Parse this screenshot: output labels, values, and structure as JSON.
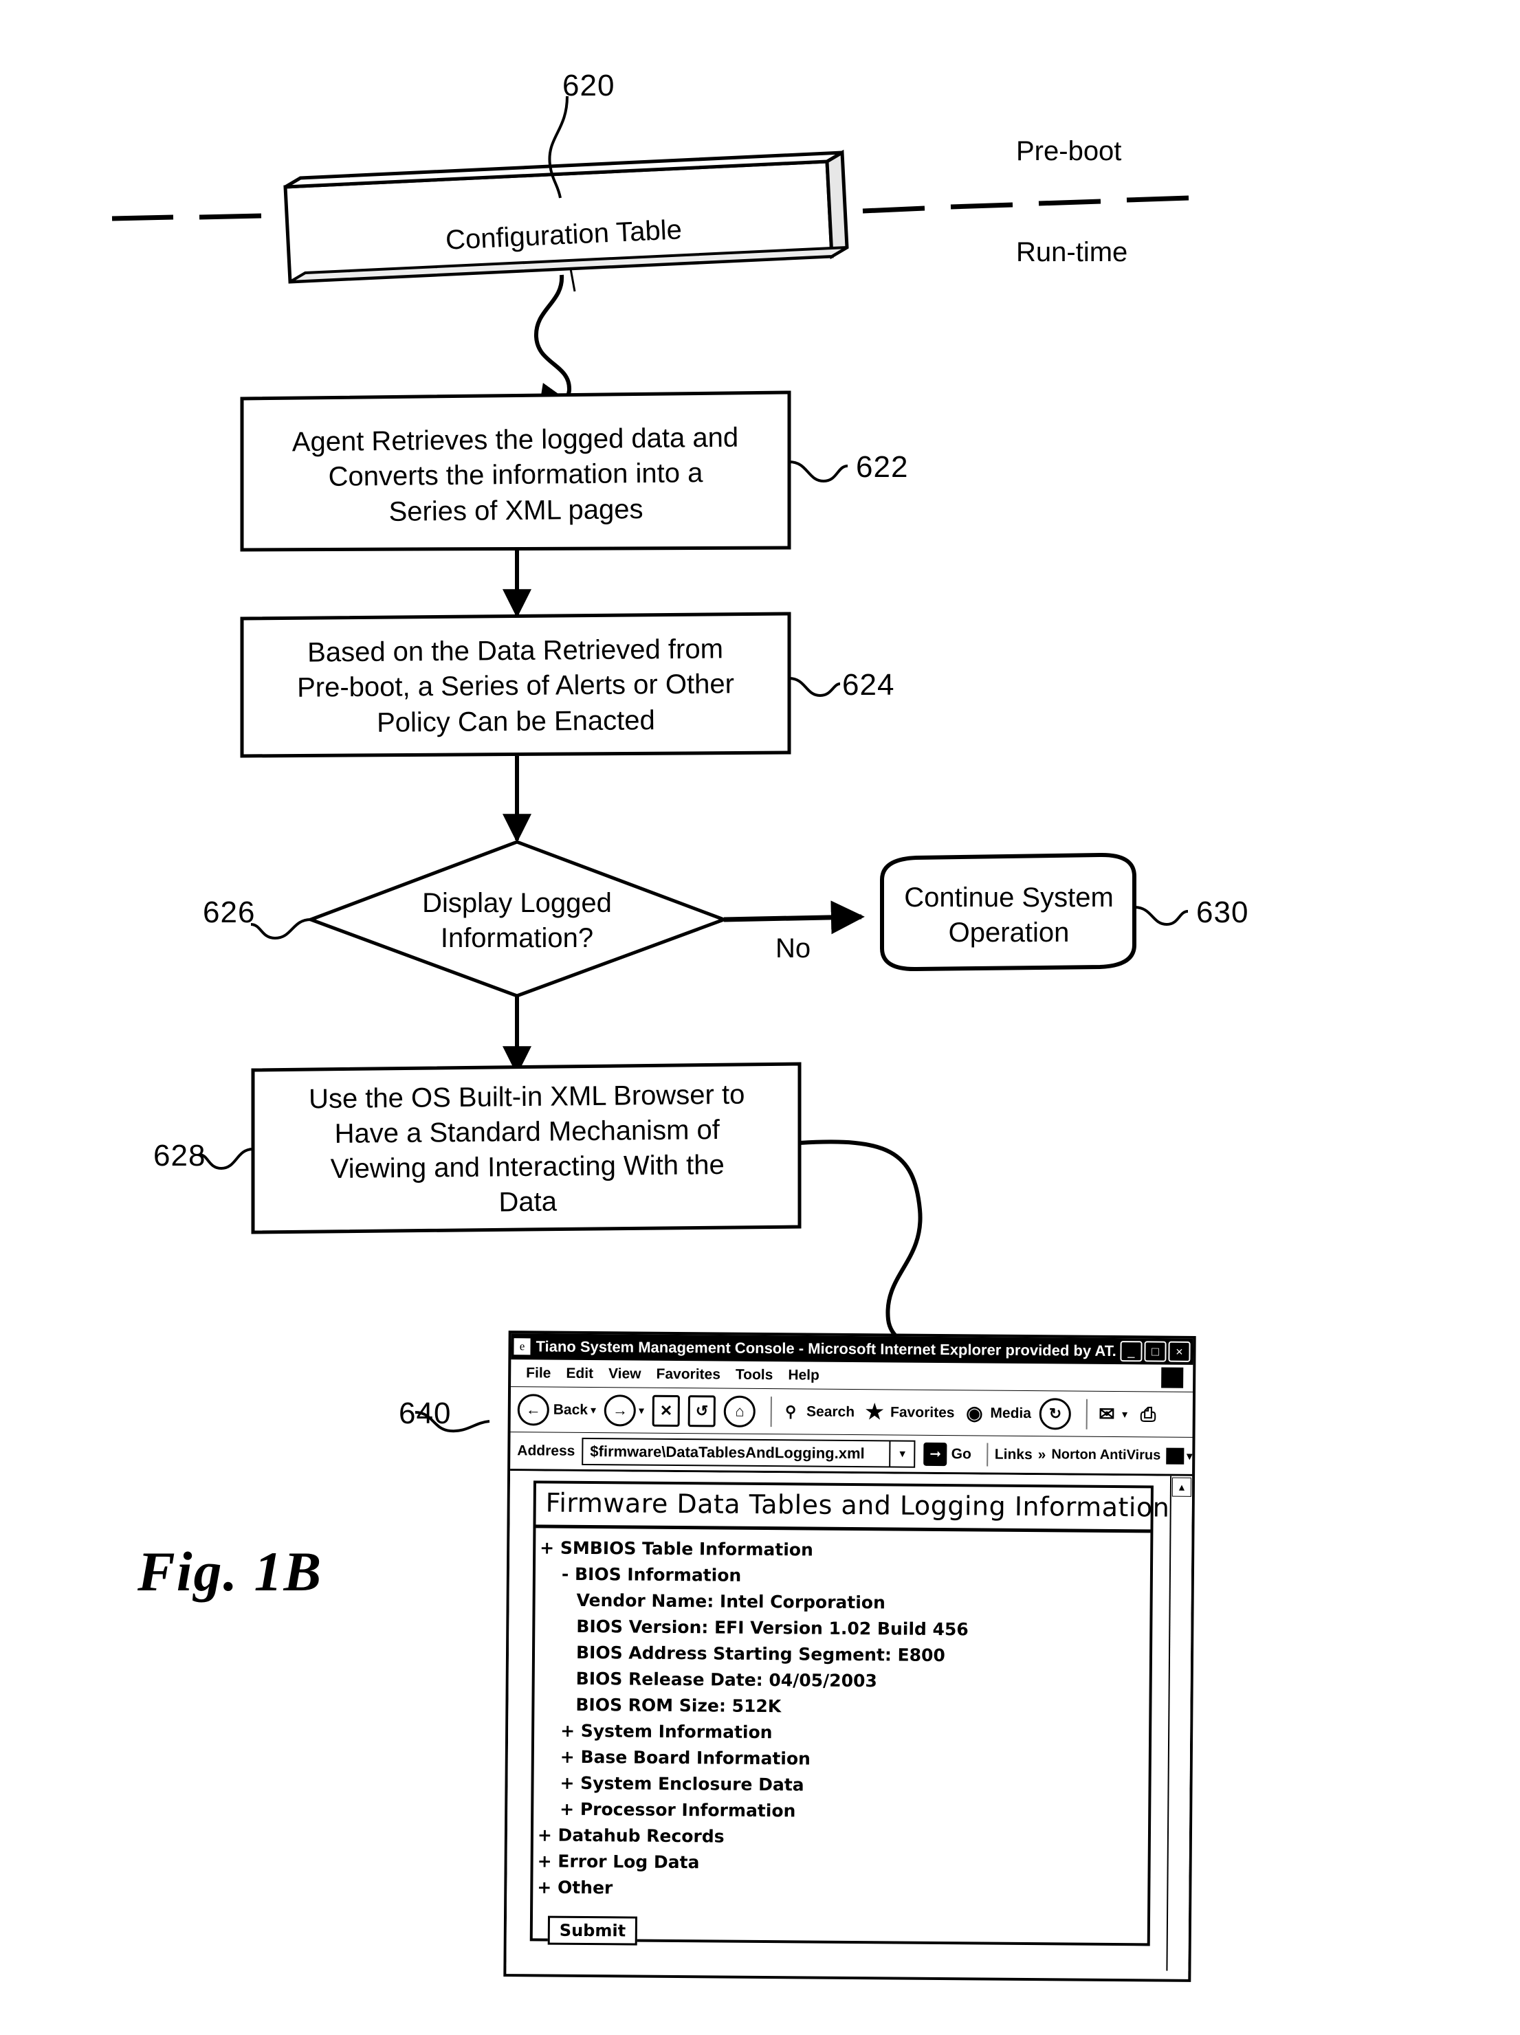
{
  "figure": {
    "caption": "Fig. 1B"
  },
  "flow": {
    "config_table": {
      "ref": "620",
      "label": "Configuration Table"
    },
    "phase_labels": {
      "preboot": "Pre-boot",
      "runtime": "Run-time"
    },
    "steps": [
      {
        "ref": "622",
        "text": "Agent Retrieves the logged data and\nConverts the information into a\nSeries of XML pages"
      },
      {
        "ref": "624",
        "text": "Based on the Data Retrieved from\nPre-boot, a Series of Alerts or Other\nPolicy Can be Enacted"
      }
    ],
    "decision": {
      "ref": "626",
      "text": "Display Logged\nInformation?",
      "no_label": "No"
    },
    "terminal": {
      "ref": "630",
      "text": "Continue System\nOperation"
    },
    "final_step": {
      "ref": "628",
      "text": "Use the OS Built-in XML Browser to\nHave a Standard Mechanism of\nViewing and Interacting With the\nData"
    },
    "browser_ref": "640"
  },
  "browser": {
    "title": "Tiano System Management Console - Microsoft Internet Explorer provided by AT...",
    "title_icon": "ie-page-icon",
    "window_buttons": [
      {
        "name": "minimize",
        "glyph": "_"
      },
      {
        "name": "restore",
        "glyph": "□"
      },
      {
        "name": "close",
        "glyph": "×"
      }
    ],
    "menu": [
      "File",
      "Edit",
      "View",
      "Favorites",
      "Tools",
      "Help"
    ],
    "toolbar": [
      {
        "name": "back-button",
        "label": "Back",
        "glyph": "←",
        "shape": "circle",
        "caret": true
      },
      {
        "name": "forward-button",
        "label": "",
        "glyph": "→",
        "shape": "circle",
        "caret": true
      },
      {
        "name": "stop-button",
        "label": "",
        "glyph": "×",
        "shape": "square",
        "caret": false
      },
      {
        "name": "refresh-button",
        "label": "",
        "glyph": "↻",
        "shape": "square",
        "caret": false
      },
      {
        "name": "home-button",
        "label": "",
        "glyph": "⌂",
        "shape": "circle",
        "caret": false
      },
      {
        "name": "search-button",
        "label": "Search",
        "glyph": "⌕",
        "shape": "none",
        "caret": false
      },
      {
        "name": "favorites-button",
        "label": "Favorites",
        "glyph": "☆",
        "shape": "none",
        "caret": false
      },
      {
        "name": "media-button",
        "label": "Media",
        "glyph": "◑",
        "shape": "none",
        "caret": false
      },
      {
        "name": "history-button",
        "label": "",
        "glyph": "↺",
        "shape": "circle",
        "caret": false
      },
      {
        "name": "mail-button",
        "label": "",
        "glyph": "✉",
        "shape": "none",
        "caret": true
      },
      {
        "name": "print-button",
        "label": "",
        "glyph": "⎙",
        "shape": "none",
        "caret": false
      }
    ],
    "address": {
      "label": "Address",
      "value": "$firmware\\DataTablesAndLogging.xml",
      "go_label": "Go",
      "dropdown_icon": "chevron-down-icon"
    },
    "links_label": "Links",
    "links_overflow": "»",
    "norton_label": "Norton AntiVirus"
  },
  "page": {
    "heading": "Firmware Data Tables and Logging Information",
    "tree": [
      {
        "marker": "+",
        "label": "SMBIOS Table Information",
        "indent": 0
      },
      {
        "marker": "-",
        "label": "BIOS Information",
        "indent": 1
      },
      {
        "marker": "",
        "label": "Vendor Name: Intel Corporation",
        "indent": 2
      },
      {
        "marker": "",
        "label": "BIOS Version: EFI Version 1.02 Build 456",
        "indent": 2
      },
      {
        "marker": "",
        "label": "BIOS Address Starting Segment: E800",
        "indent": 2
      },
      {
        "marker": "",
        "label": "BIOS Release Date: 04/05/2003",
        "indent": 2
      },
      {
        "marker": "",
        "label": "BIOS ROM Size: 512K",
        "indent": 2
      },
      {
        "marker": "+",
        "label": "System Information",
        "indent": 1
      },
      {
        "marker": "+",
        "label": "Base Board Information",
        "indent": 1
      },
      {
        "marker": "+",
        "label": "System Enclosure Data",
        "indent": 1
      },
      {
        "marker": "+",
        "label": "Processor Information",
        "indent": 1
      },
      {
        "marker": "+",
        "label": "Datahub Records",
        "indent": 0
      },
      {
        "marker": "+",
        "label": "Error Log Data",
        "indent": 0
      },
      {
        "marker": "+",
        "label": "Other",
        "indent": 0
      }
    ],
    "submit_label": "Submit"
  }
}
